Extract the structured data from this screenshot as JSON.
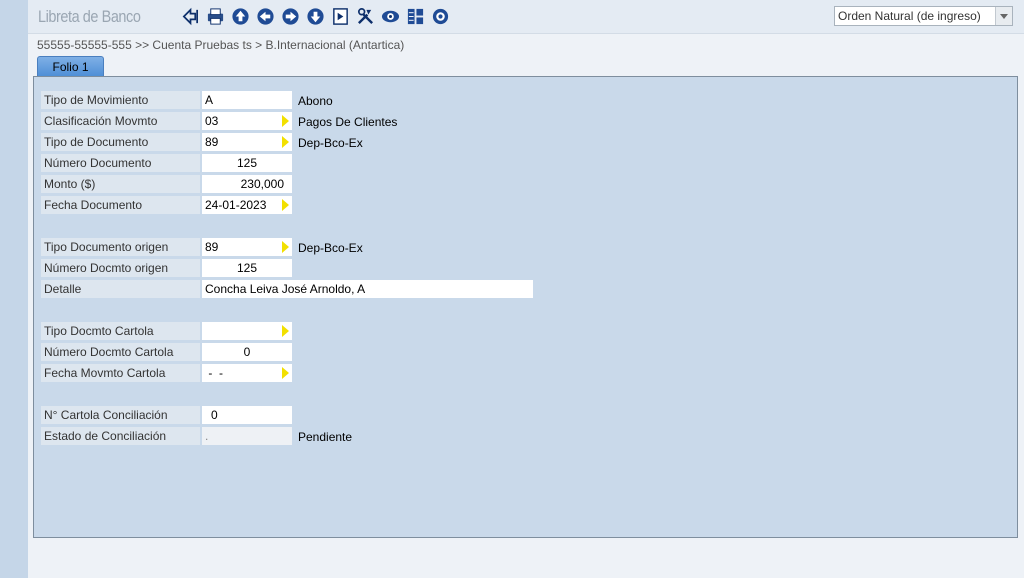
{
  "app": {
    "title": "Libreta de Banco"
  },
  "toolbar": {
    "icons": [
      "back-icon",
      "print-icon",
      "first-icon",
      "prev-icon",
      "next-icon",
      "last-icon",
      "grid-icon",
      "tools-icon",
      "view-icon",
      "list-icon",
      "settings-icon"
    ],
    "order_select": {
      "value": "Orden Natural (de ingreso)"
    }
  },
  "breadcrumb": "55555-55555-555 >> Cuenta Pruebas ts > B.Internacional  (Antartica)",
  "tab": {
    "label": "Folio 1"
  },
  "form": {
    "tipo_movimiento": {
      "label": "Tipo de Movimiento",
      "value": "A",
      "desc": "Abono"
    },
    "clasificacion": {
      "label": "Clasificación Movmto",
      "value": "03",
      "desc": "Pagos De Clientes"
    },
    "tipo_documento": {
      "label": "Tipo de Documento",
      "value": "89",
      "desc": "Dep-Bco-Ex"
    },
    "numero_documento": {
      "label": "Número Documento",
      "value": "125"
    },
    "monto": {
      "label": "Monto ($)",
      "value": "230,000"
    },
    "fecha_documento": {
      "label": "Fecha Documento",
      "value": "24-01-2023"
    },
    "tipo_doc_origen": {
      "label": "Tipo Documento origen",
      "value": "89",
      "desc": "Dep-Bco-Ex"
    },
    "numero_doc_origen": {
      "label": "Número Docmto origen",
      "value": "125"
    },
    "detalle": {
      "label": "Detalle",
      "value": "Concha Leiva José Arnoldo, A"
    },
    "tipo_doc_cartola": {
      "label": "Tipo Docmto Cartola",
      "value": ""
    },
    "numero_doc_cartola": {
      "label": "Número Docmto Cartola",
      "value": "0"
    },
    "fecha_mov_cartola": {
      "label": "Fecha Movmto Cartola",
      "value": " -  -"
    },
    "cartola_conciliacion": {
      "label": "N° Cartola Conciliación",
      "value": "0"
    },
    "estado_conciliacion": {
      "label": "Estado de Conciliación",
      "value": ".",
      "desc": "Pendiente"
    }
  },
  "colors": {
    "tab": "#5b97dc",
    "panel": "#c9d9ea",
    "lookup_arrow": "#f2e000"
  }
}
